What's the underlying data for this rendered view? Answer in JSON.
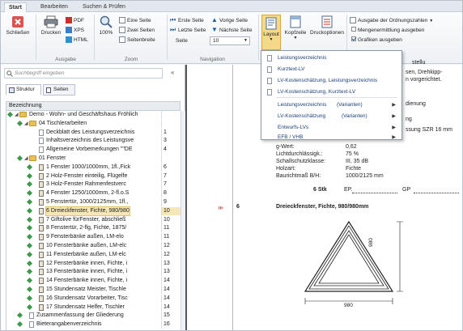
{
  "tabs": [
    "Start",
    "Bearbeiten",
    "Suchen & Prüfen"
  ],
  "ribbon": {
    "schliessen": "Schließen",
    "drucken": "Drucken",
    "pdf": "PDF",
    "xps": "XPS",
    "html": "HTML",
    "ausgabe": "Ausgabe",
    "zoom_value": "100%",
    "eine_seite": "Eine Seite",
    "zwei_seiten": "Zwei Seiten",
    "seitenbreite": "Seitenbreite",
    "zoom": "Zoom",
    "erste_seite": "Erste Seite",
    "letzte_seite": "Letzte Seite",
    "vorige_seite": "Vorige Seite",
    "naechste_seite": "Nächste Seite",
    "seite_label": "Seite",
    "seite_value": "10",
    "navigation": "Navigation",
    "layout": "Layout",
    "kopfzeile": "Kopfzeile",
    "druckoptionen": "Druckoptionen",
    "ordnungszahlen": "Ausgabe der Ordnungszahlen",
    "mengenermittlung": "Mengenermittlung ausgeben",
    "grafiken": "Grafiken ausgeben"
  },
  "left": {
    "search_placeholder": "Suchbegriff eingeben",
    "tab_struktur": "Struktur",
    "tab_seiten": "Seiten",
    "column": "Bezeichnung"
  },
  "tree": [
    {
      "text": "Demo - Wohn- und Geschäftshaus Fröhlich",
      "num": ""
    },
    {
      "text": "04 Tischlerarbeiten",
      "num": ""
    },
    {
      "text": "Deckblatt des Leistungsverzeichnis",
      "num": "1"
    },
    {
      "text": "Inhaltsverzeichnis des Leistungsve",
      "num": "3"
    },
    {
      "text": "Allgemeine Vorbemerkungen \"\"DE",
      "num": "4"
    },
    {
      "text": "01 Fenster",
      "num": ""
    },
    {
      "text": "1 Fenster 1000/1000mm, 1fl.,Fick",
      "num": "6"
    },
    {
      "text": "2 Holz-Fenster einteilig, Flügelfe",
      "num": "7"
    },
    {
      "text": "3 Holz-Fenster Rahmenfestverc",
      "num": "7"
    },
    {
      "text": "4 Fenster 1250/1000mm, 2-fl.o.S",
      "num": "8"
    },
    {
      "text": "5 Fenstertür, 1000/2125mm, 1fl.,",
      "num": "9"
    },
    {
      "text": "6 Dreieckfenster, Fichte, 980/980",
      "num": "10"
    },
    {
      "text": "7 Giftolive fürFenster, abschließ",
      "num": "10"
    },
    {
      "text": "8 Fenstertür, 2-flg, Fichte, 1875/",
      "num": "11"
    },
    {
      "text": "9 Fensterbänke außen, LM-elo",
      "num": "11"
    },
    {
      "text": "10 Fensterbänke außen, LM-elc",
      "num": "12"
    },
    {
      "text": "11 Fensterbänke außen, LM-elc",
      "num": "12"
    },
    {
      "text": "12 Fensterbänke innen, Fichte, i",
      "num": "13"
    },
    {
      "text": "13 Fensterbänke innen, Fichte, i",
      "num": "13"
    },
    {
      "text": "14 Fensterbänke innen, Fichte, i",
      "num": "14"
    },
    {
      "text": "15 Stundensatz Meister, Tischle",
      "num": "14"
    },
    {
      "text": "16 Stundensatz Vorarbeiter, Tisc",
      "num": "14"
    },
    {
      "text": "17 Stundensatz Helfer, Tischler",
      "num": "14"
    },
    {
      "text": "Zusammenfassung der Gliederung",
      "num": "15"
    },
    {
      "text": "Bieterangabenverzeichnis",
      "num": "16"
    }
  ],
  "dropdown": [
    {
      "label": "Leistungsverzeichnis",
      "sub": false
    },
    {
      "label": "Kurztext-LV",
      "sub": false
    },
    {
      "label": "LV-Kostenschätzung, Leistungsverzeichnis",
      "sub": false
    },
    {
      "label": "LV-Kostenschätzung, Kurztext-LV",
      "sub": false
    },
    {
      "label": "Leistungsverzeichnis       (Varianten)",
      "sub": true
    },
    {
      "label": "LV-Kostenschätzung           (Varianten)",
      "sub": true
    },
    {
      "label": "Entwurfs-LVs",
      "sub": true
    },
    {
      "label": "EFB / VHB",
      "sub": true
    }
  ],
  "doc": {
    "frag1": "stellu",
    "frag2": "sen, Drehkipp-",
    "frag3": "n vorgerichtet.",
    "frag4": "dienung",
    "frag5": "ng",
    "frag6": "ssung SZR 16 mm",
    "frag7": "",
    "g_label": "g-Wert:",
    "g_val": "0,62",
    "licht_label": "Lichtdurchlässigk.:",
    "licht_val": "75 %",
    "schall_label": "Schallschutzklasse:",
    "schall_val": "III, 35 dB",
    "holz_label": "Holzart:",
    "holz_val": "Fichte",
    "bau_label": "Baurichtmaß B/H:",
    "bau_val": "1000/2125 mm",
    "stk": "6 Stk",
    "ep": "EP.",
    "gp": "GP",
    "pos_num": "6",
    "pos_title": "Dreieckfenster, Fichte, 980/980mm",
    "dim_h": "980",
    "dim_v": "980"
  },
  "colors": {
    "accent": "#1a5c9e",
    "selection": "#f6e8b6",
    "marker": "#c0392b",
    "diamond": "#3c9a4a"
  }
}
